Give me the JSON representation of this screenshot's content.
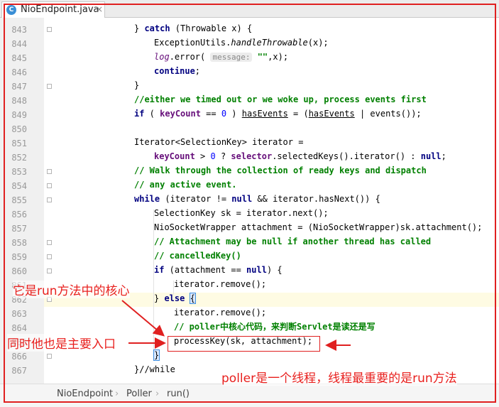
{
  "tab": {
    "icon": "C",
    "filename": "NioEndpoint.java",
    "close": "×"
  },
  "gutter": {
    "line_numbers": [
      "843",
      "844",
      "845",
      "846",
      "847",
      "848",
      "849",
      "850",
      "851",
      "852",
      "853",
      "854",
      "855",
      "856",
      "857",
      "858",
      "859",
      "860",
      "861",
      "862",
      "863",
      "864",
      "865",
      "866",
      "867"
    ]
  },
  "code": {
    "l843_a": "} ",
    "l843_catch": "catch",
    "l843_b": " (Throwable x) {",
    "l844_a": "ExceptionUtils.",
    "l844_fn": "handleThrowable",
    "l844_b": "(x);",
    "l845_log": "log",
    "l845_a": ".error( ",
    "l845_hint": "message:",
    "l845_str": " \"\"",
    "l845_b": ",x);",
    "l846_kw": "continue",
    "l846_b": ";",
    "l847": "}",
    "l848": "//either we timed out or we woke up, process events first",
    "l849_if": "if",
    "l849_a": " ( ",
    "l849_kc": "keyCount",
    "l849_b": " == ",
    "l849_n": "0",
    "l849_c": " ) ",
    "l849_he": "hasEvents",
    "l849_d": " = (",
    "l849_he2": "hasEvents",
    "l849_e": " | events());",
    "l851": "Iterator<SelectionKey> iterator =",
    "l852_kc": "keyCount",
    "l852_a": " > ",
    "l852_n": "0",
    "l852_b": " ? ",
    "l852_sel": "selector",
    "l852_c": ".selectedKeys().iterator() : ",
    "l852_null": "null",
    "l852_d": ";",
    "l853": "// Walk through the collection of ready keys and dispatch",
    "l854": "// any active event.",
    "l855_while": "while",
    "l855_a": " (iterator != ",
    "l855_null": "null",
    "l855_b": " && iterator.hasNext()) {",
    "l856": "SelectionKey sk = iterator.next();",
    "l857": "NioSocketWrapper attachment = (NioSocketWrapper)sk.attachment();",
    "l858": "// Attachment may be null if another thread has called",
    "l859": "// cancelledKey()",
    "l860_if": "if",
    "l860_a": " (attachment == ",
    "l860_null": "null",
    "l860_b": ") {",
    "l861": "iterator.remove();",
    "l862_a": "} ",
    "l862_else": "else",
    "l862_b": " ",
    "l862_brace": "{",
    "l863": "iterator.remove();",
    "l864": "// poller中核心代码，来判断Servlet是读还是写",
    "l865": "processKey(sk, attachment);",
    "l866": "}",
    "l867": "}//while"
  },
  "annotations": {
    "core": "它是run方法中的核心",
    "entry": "同时他也是主要入口",
    "poller": "poller是一个线程，线程最重要的是run方法"
  },
  "breadcrumb": {
    "items": [
      "NioEndpoint",
      "Poller",
      "run()"
    ],
    "separator": "›"
  },
  "colors": {
    "annotation": "#e8201e",
    "keyword": "#000080",
    "field": "#660e7a",
    "comment": "#808080",
    "string": "#008000",
    "number": "#0000ff"
  }
}
